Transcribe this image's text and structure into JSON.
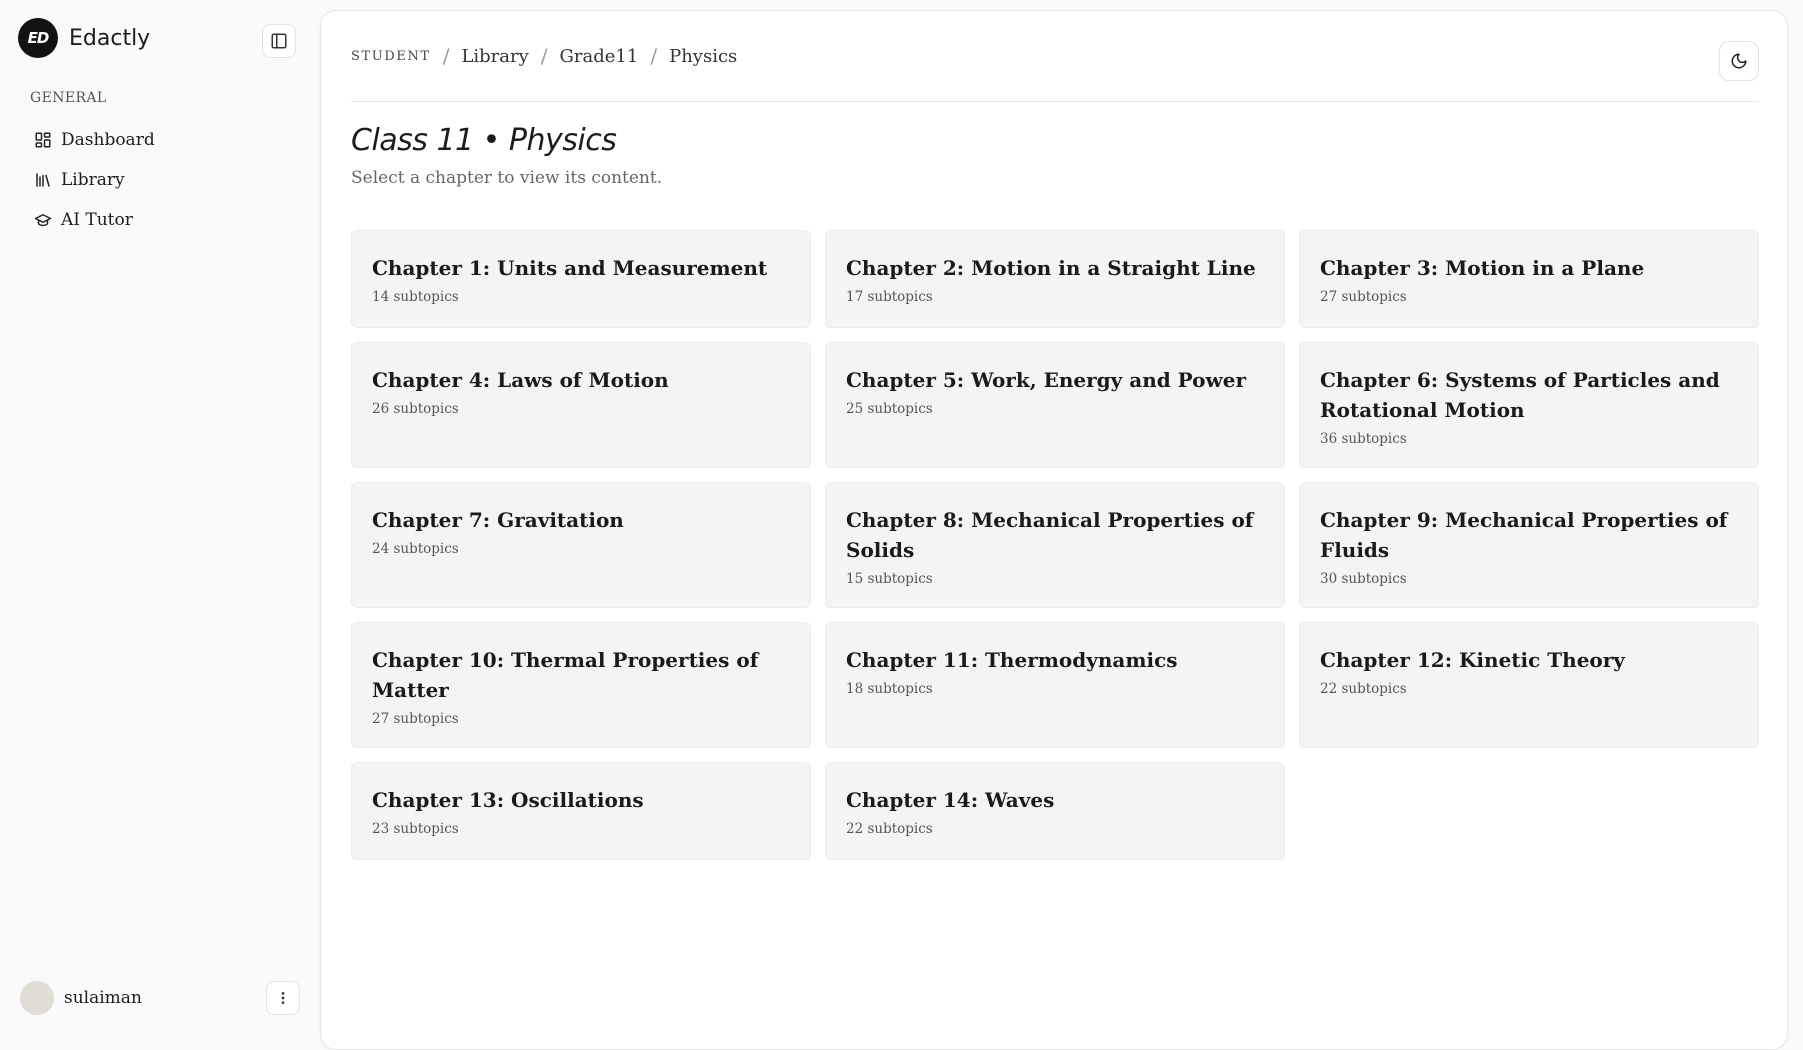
{
  "brand": {
    "logo_text": "ED",
    "name": "Edactly"
  },
  "sidebar": {
    "section_label": "GENERAL",
    "items": [
      {
        "label": "Dashboard",
        "icon": "dashboard-icon"
      },
      {
        "label": "Library",
        "icon": "library-icon"
      },
      {
        "label": "AI Tutor",
        "icon": "graduation-cap-icon"
      }
    ]
  },
  "user": {
    "name": "sulaiman"
  },
  "breadcrumb": {
    "root": "STUDENT",
    "items": [
      "Library",
      "Grade11",
      "Physics"
    ]
  },
  "page": {
    "title": "Class 11 • Physics",
    "subtitle": "Select a chapter to view its content."
  },
  "chapters": [
    {
      "title": "Chapter 1: Units and Measurement",
      "subtopics": "14 subtopics"
    },
    {
      "title": "Chapter 2: Motion in a Straight Line",
      "subtopics": "17 subtopics"
    },
    {
      "title": "Chapter 3: Motion in a Plane",
      "subtopics": "27 subtopics"
    },
    {
      "title": "Chapter 4: Laws of Motion",
      "subtopics": "26 subtopics"
    },
    {
      "title": "Chapter 5: Work, Energy and Power",
      "subtopics": "25 subtopics"
    },
    {
      "title": "Chapter 6: Systems of Particles and Rotational Motion",
      "subtopics": "36 subtopics"
    },
    {
      "title": "Chapter 7: Gravitation",
      "subtopics": "24 subtopics"
    },
    {
      "title": "Chapter 8: Mechanical Properties of Solids",
      "subtopics": "15 subtopics"
    },
    {
      "title": "Chapter 9: Mechanical Properties of Fluids",
      "subtopics": "30 subtopics"
    },
    {
      "title": "Chapter 10: Thermal Properties of Matter",
      "subtopics": "27 subtopics"
    },
    {
      "title": "Chapter 11: Thermodynamics",
      "subtopics": "18 subtopics"
    },
    {
      "title": "Chapter 12: Kinetic Theory",
      "subtopics": "22 subtopics"
    },
    {
      "title": "Chapter 13: Oscillations",
      "subtopics": "23 subtopics"
    },
    {
      "title": "Chapter 14: Waves",
      "subtopics": "22 subtopics"
    }
  ],
  "icons": {
    "collapse": "sidebar-toggle-icon",
    "theme": "moon-icon",
    "user_menu": "more-vertical-icon"
  }
}
